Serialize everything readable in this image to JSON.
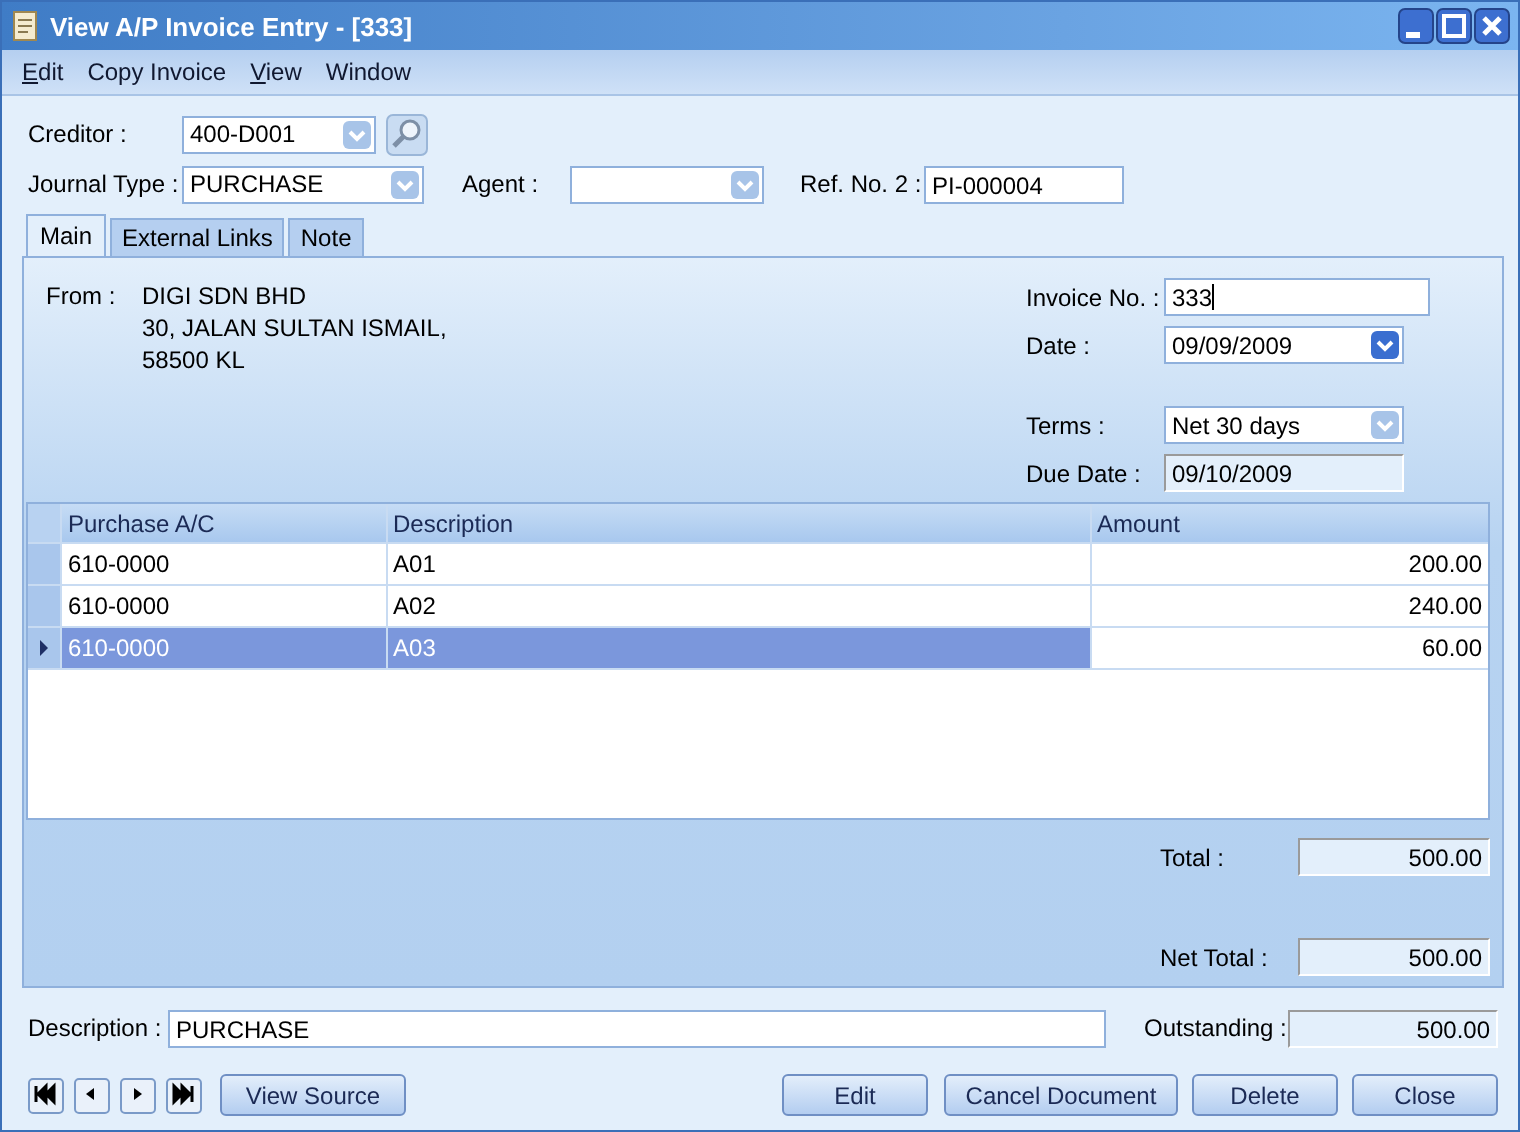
{
  "window": {
    "title": "View A/P Invoice Entry - [333]"
  },
  "menu": [
    {
      "label": "Edit",
      "underlined": true
    },
    {
      "label": "Copy Invoice",
      "underlined": false
    },
    {
      "label": "View",
      "underlined": true
    },
    {
      "label": "Window",
      "underlined": false
    }
  ],
  "header": {
    "creditor": {
      "label": "Creditor :",
      "value": "400-D001",
      "disabled": true
    },
    "journal_type": {
      "label": "Journal Type :",
      "value": "PURCHASE",
      "disabled": true
    },
    "agent": {
      "label": "Agent :",
      "disabled": true
    },
    "ref_no_2": {
      "label": "Ref. No. 2 :",
      "value": "PI-000004"
    }
  },
  "tabs": [
    {
      "label": "Main",
      "selected": true
    },
    {
      "label": "External Links",
      "selected": false
    },
    {
      "label": "Note",
      "selected": false
    }
  ],
  "main": {
    "from_label": "From :",
    "address": [
      "DIGI SDN BHD",
      "30, JALAN SULTAN ISMAIL,",
      "58500 KL"
    ],
    "invoice_no": {
      "label": "Invoice No. :",
      "value": "333"
    },
    "date": {
      "label": "Date :",
      "value": "09/09/2009",
      "disabled": false
    },
    "terms": {
      "label": "Terms :",
      "value": "Net 30 days",
      "disabled": true
    },
    "due_date": {
      "label": "Due Date :",
      "value": "09/10/2009"
    }
  },
  "table": {
    "columns": [
      "Purchase A/C",
      "Description",
      "Amount"
    ],
    "rows": [
      {
        "cells": [
          "610-0000",
          "A01",
          "200.00"
        ],
        "selected": false
      },
      {
        "cells": [
          "610-0000",
          "A02",
          "240.00"
        ],
        "selected": false
      },
      {
        "cells": [
          "610-0000",
          "A03",
          "60.00"
        ],
        "selected": true
      }
    ]
  },
  "totals": {
    "total": {
      "label": "Total :",
      "value": "500.00"
    },
    "net_total": {
      "label": "Net Total :",
      "value": "500.00"
    }
  },
  "footer": {
    "description": {
      "label": "Description :",
      "value": "PURCHASE"
    },
    "outstanding": {
      "label": "Outstanding :",
      "value": "500.00"
    },
    "buttons": [
      "View Source",
      "Edit",
      "Cancel Document",
      "Delete",
      "Close"
    ]
  }
}
